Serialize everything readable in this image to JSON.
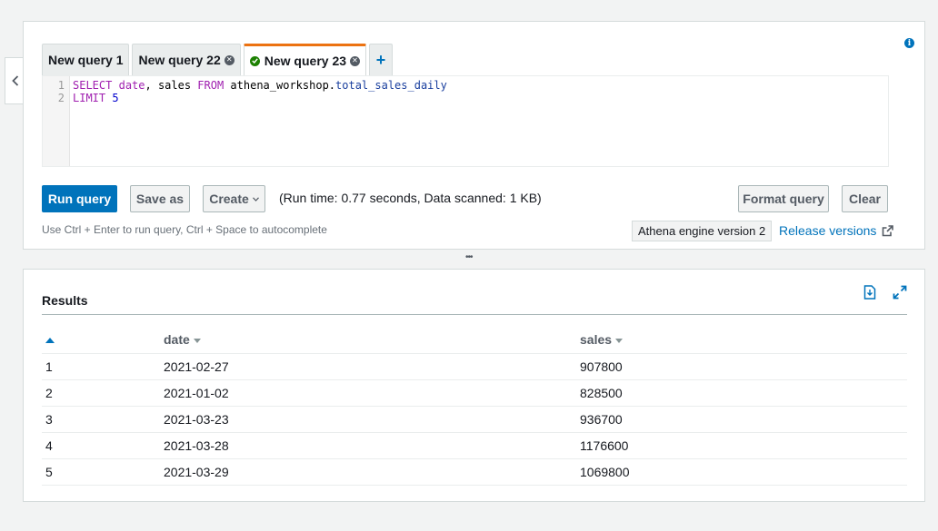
{
  "editor": {
    "tabs": [
      {
        "label": "New query 1",
        "closable": false,
        "active": false
      },
      {
        "label": "New query 22",
        "closable": true,
        "active": false
      },
      {
        "label": "New query 23",
        "closable": true,
        "active": true,
        "status": "success"
      }
    ],
    "add_tab_label": "+",
    "line_numbers": [
      "1",
      "2"
    ],
    "code_lines": [
      [
        {
          "t": "SELECT",
          "k": "kw"
        },
        {
          "t": " "
        },
        {
          "t": "date",
          "k": "kw"
        },
        {
          "t": ", sales "
        },
        {
          "t": "FROM",
          "k": "kw"
        },
        {
          "t": " athena_workshop."
        },
        {
          "t": "total_sales_daily",
          "k": "id-blue"
        }
      ],
      [
        {
          "t": "LIMIT",
          "k": "kw"
        },
        {
          "t": " "
        },
        {
          "t": "5",
          "k": "num"
        }
      ]
    ],
    "run_label": "Run query",
    "save_as_label": "Save as",
    "create_label": "Create",
    "run_info": "(Run time: 0.77 seconds, Data scanned: 1 KB)",
    "format_label": "Format query",
    "clear_label": "Clear",
    "hint": "Use Ctrl + Enter to run query, Ctrl + Space to autocomplete",
    "engine_version": "Athena engine version 2",
    "release_link": "Release versions"
  },
  "results": {
    "title": "Results",
    "columns": [
      "",
      "date",
      "sales"
    ],
    "rows": [
      [
        "1",
        "2021-02-27",
        "907800"
      ],
      [
        "2",
        "2021-01-02",
        "828500"
      ],
      [
        "3",
        "2021-03-23",
        "936700"
      ],
      [
        "4",
        "2021-03-28",
        "1176600"
      ],
      [
        "5",
        "2021-03-29",
        "1069800"
      ]
    ]
  },
  "colors": {
    "primary": "#0073bb",
    "active_tab_accent": "#ec7211",
    "success": "#1d8102"
  }
}
